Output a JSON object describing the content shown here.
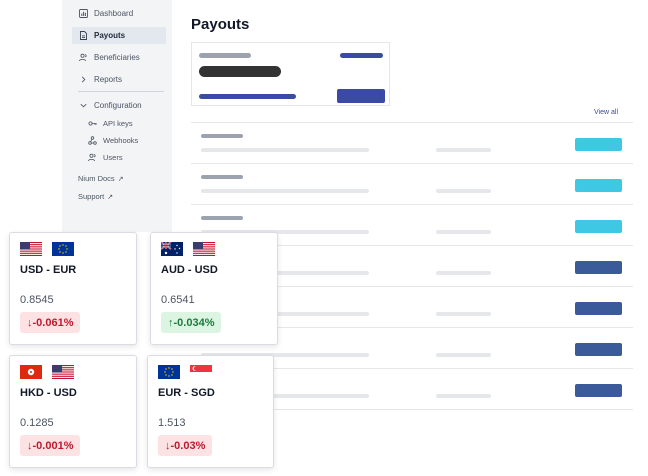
{
  "sidebar": {
    "items": [
      {
        "label": "Dashboard",
        "icon": "dashboard-icon"
      },
      {
        "label": "Payouts",
        "icon": "document-icon",
        "active": true
      },
      {
        "label": "Beneficiaries",
        "icon": "users-icon"
      },
      {
        "label": "Reports",
        "icon": "chevron-right-icon"
      },
      {
        "label": "Configuration",
        "icon": "chevron-down-icon"
      }
    ],
    "subitems": [
      {
        "label": "API keys",
        "icon": "key-icon"
      },
      {
        "label": "Webhooks",
        "icon": "webhook-icon"
      },
      {
        "label": "Users",
        "icon": "users-icon"
      }
    ],
    "links": [
      {
        "label": "Nium Docs",
        "arrow": "↗"
      },
      {
        "label": "Support",
        "arrow": "↗"
      }
    ]
  },
  "main": {
    "title": "Payouts",
    "view_all": "View all"
  },
  "colors": {
    "accent": "#3b4aa5",
    "cyan_button": "#3ec8e3",
    "navy_button": "#3b5a99",
    "down_bg": "#fde2e4",
    "down_text": "#c0182f",
    "up_bg": "#dcf5e3",
    "up_text": "#1d7a3c"
  },
  "fx_cards": [
    {
      "pair": "USD - EUR",
      "rate": "0.8545",
      "change": "↓-0.061%",
      "direction": "down",
      "flags": [
        "us-flag",
        "eu-flag"
      ]
    },
    {
      "pair": "AUD - USD",
      "rate": "0.6541",
      "change": "↑-0.034%",
      "direction": "up",
      "flags": [
        "au-flag",
        "us-flag"
      ]
    },
    {
      "pair": "HKD - USD",
      "rate": "0.1285",
      "change": "↓-0.001%",
      "direction": "down",
      "flags": [
        "hk-flag",
        "us-flag"
      ]
    },
    {
      "pair": "EUR - SGD",
      "rate": "1.513",
      "change": "↓-0.03%",
      "direction": "down",
      "flags": [
        "eu-flag",
        "sg-flag"
      ]
    }
  ]
}
